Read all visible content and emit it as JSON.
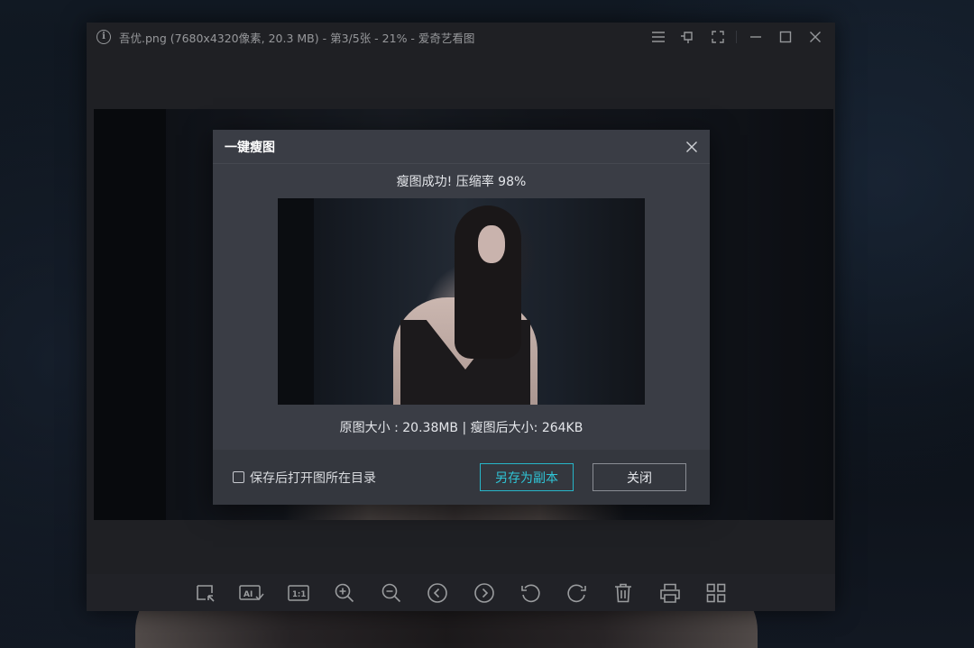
{
  "window": {
    "title": "吾优.png (7680x4320像素, 20.3 MB) - 第3/5张 - 21% - 爱奇艺看图",
    "controls": [
      "menu-icon",
      "pin-icon",
      "fullscreen-icon",
      "minimize-icon",
      "maximize-icon",
      "close-icon"
    ]
  },
  "dialog": {
    "title": "一键瘦图",
    "status": "瘦图成功! 压缩率 98%",
    "size_info": "原图大小 : 20.38MB | 瘦图后大小: 264KB",
    "checkbox_label": "保存后打开图所在目录",
    "checkbox_checked": false,
    "save_copy_label": "另存为副本",
    "close_label": "关闭",
    "accent_color": "#27b6c9"
  },
  "toolbar": {
    "buttons": [
      "crop-icon",
      "ai-edit-icon",
      "actual-size-icon",
      "zoom-in-icon",
      "zoom-out-icon",
      "previous-icon",
      "next-icon",
      "rotate-left-icon",
      "rotate-right-icon",
      "delete-icon",
      "print-icon",
      "grid-view-icon"
    ]
  }
}
